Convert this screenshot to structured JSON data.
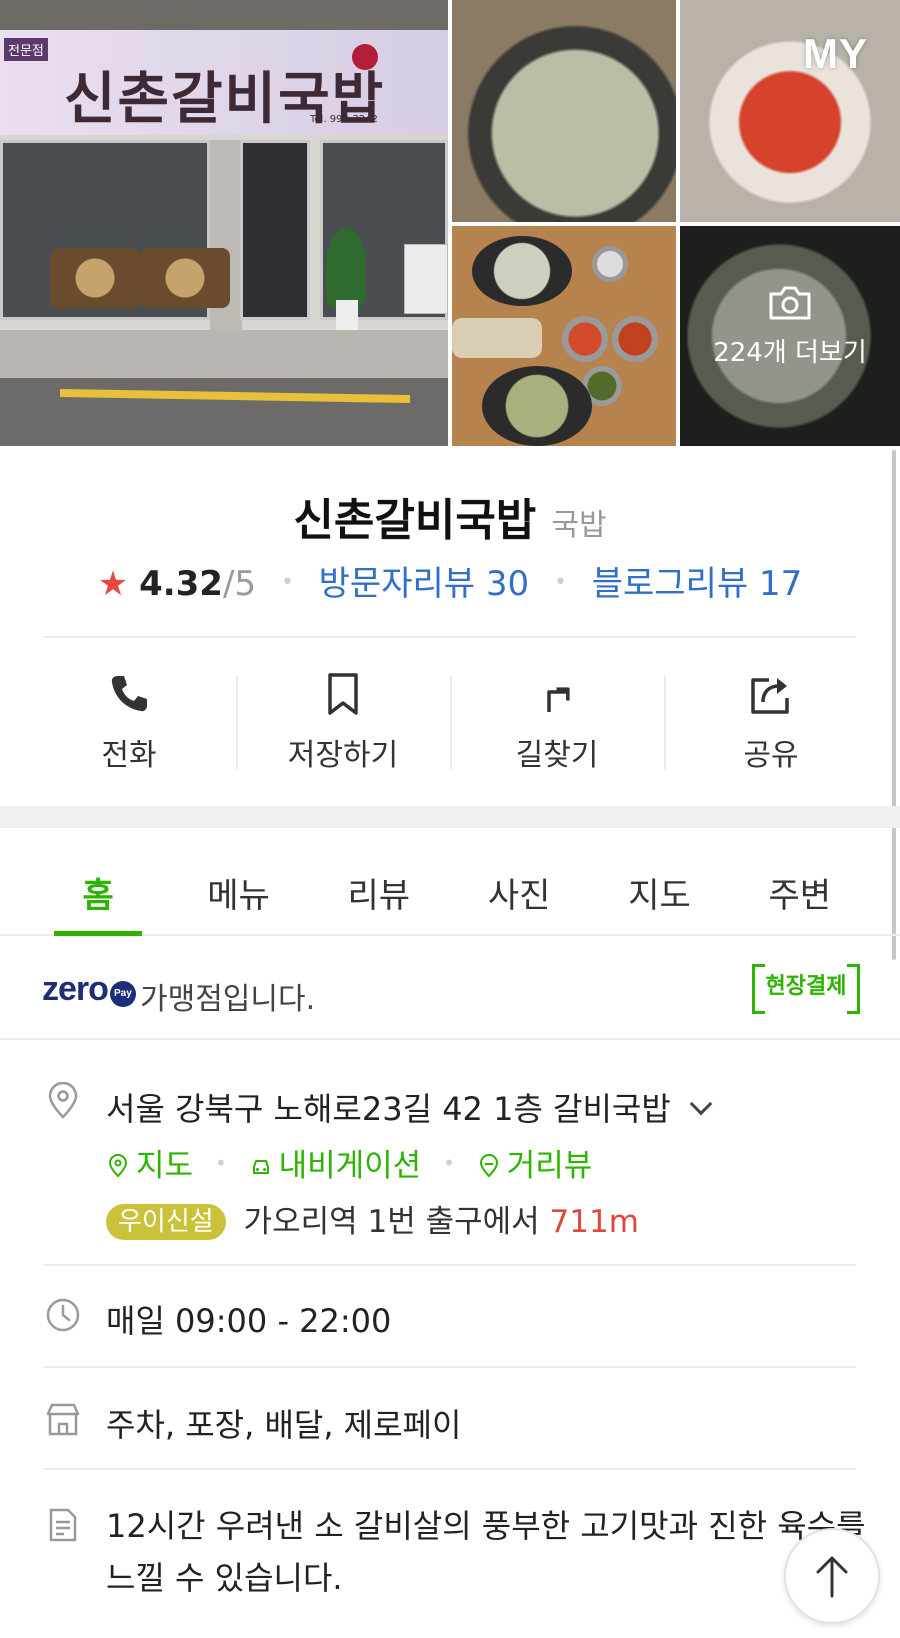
{
  "gallery": {
    "main_photo": "storefront-photo",
    "storefront_sign": {
      "tag": "전문점",
      "title": "신촌갈비국밥",
      "tel": "Tel. 990-3242"
    },
    "my_badge": "MY",
    "more_label": "224개 더보기",
    "more_icon": "camera-icon"
  },
  "place": {
    "name": "신촌갈비국밥",
    "category": "국밥",
    "rating": "4.32",
    "rating_max": "/5",
    "visitor_reviews": "방문자리뷰 30",
    "blog_reviews": "블로그리뷰 17"
  },
  "actions": [
    {
      "label": "전화",
      "icon": "phone-icon"
    },
    {
      "label": "저장하기",
      "icon": "bookmark-icon"
    },
    {
      "label": "길찾기",
      "icon": "directions-icon"
    },
    {
      "label": "공유",
      "icon": "share-icon"
    }
  ],
  "tabs": [
    "홈",
    "메뉴",
    "리뷰",
    "사진",
    "지도",
    "주변"
  ],
  "active_tab": "홈",
  "zero_pay": {
    "logo": "zero",
    "logo_pay": "Pay",
    "text": "가맹점입니다.",
    "onsite_label": "현장결제"
  },
  "address": {
    "text": "서울 강북구 노해로23길 42 1층 갈비국밥",
    "links": [
      "지도",
      "내비게이션",
      "거리뷰"
    ],
    "subway_line": "우이신설",
    "station": "가오리역",
    "exit_text": "1번 출구에서",
    "distance": "711m"
  },
  "hours": "매일 09:00 - 22:00",
  "amenities": "주차, 포장, 배달, 제로페이",
  "description": "12시간 우려낸 소 갈비살의 풍부한 고기맛과 진한 육수를 느낄 수 있습니다.",
  "colors": {
    "accent_green": "#2db400",
    "link_blue": "#2f6fc8",
    "star_red": "#e8483e",
    "distance_red": "#e0473c",
    "line_badge": "#c9c23a"
  }
}
